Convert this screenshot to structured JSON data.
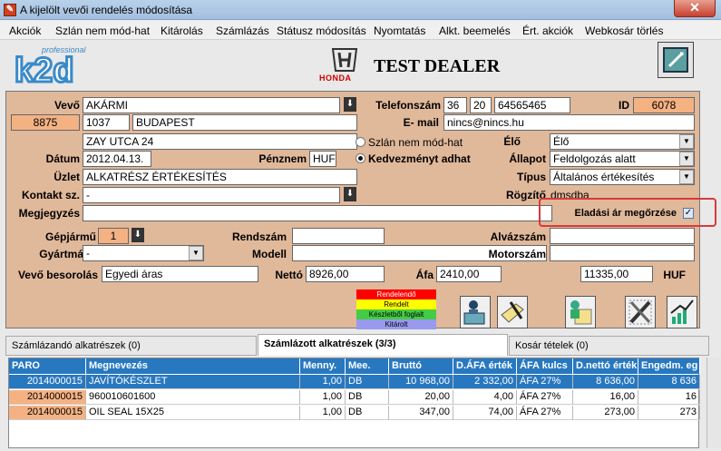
{
  "window": {
    "title": "A kijelölt vevői rendelés módosítása",
    "close": "✕"
  },
  "menu": [
    "Akciók",
    "Szlán nem mód-hat",
    "Kitárolás",
    "Számlázás",
    "Státusz módosítás",
    "Nyomtatás",
    "Alkt. beemelés",
    "Ért. akciók",
    "Webkosár törlés"
  ],
  "header": {
    "logo_small": "professional",
    "logo": "k2d",
    "brand": "HONDA",
    "dealer": "TEST DEALER"
  },
  "form": {
    "vevo_label": "Vevő",
    "vevo": "AKÁRMI",
    "telefon_label": "Telefonszám",
    "tel1": "36",
    "tel2": "20",
    "tel3": "64565465",
    "id_label": "ID",
    "id": "6078",
    "cust_code": "8875",
    "zip": "1037",
    "city": "BUDAPEST",
    "email_label": "E- mail",
    "email": "nincs@nincs.hu",
    "street": "ZAY UTCA 24",
    "radio1": "Szlán nem mód-hat",
    "radio2": "Kedvezményt adhat",
    "elo_label": "Élő",
    "elo": "Élő",
    "datum_label": "Dátum",
    "datum": "2012.04.13.",
    "penznem_label": "Pénznem",
    "penznem": "HUF",
    "allapot_label": "Állapot",
    "allapot": "Feldolgozás alatt",
    "uzlet_label": "Üzlet",
    "uzlet": "ALKATRÉSZ ÉRTÉKESÍTÉS",
    "tipus_label": "Típus",
    "tipus": "Általános értékesítés",
    "kontakt_label": "Kontakt sz.",
    "kontakt": "-",
    "rogzito_label": "Rögzítő",
    "rogzito": "dmsdba",
    "megjegyzes_label": "Megjegyzés",
    "megjegyzes": "",
    "eladasi_label": "Eladási ár megőrzése",
    "eladasi_check": "✓",
    "gepjarmu_label": "Gépjármű",
    "gepjarmu": "1",
    "rendszam_label": "Rendszám",
    "rendszam": "",
    "alvazszam_label": "Alvázszám",
    "alvazszam": "",
    "gyartmany_label": "Gyártmány",
    "gyartmany": "-",
    "modell_label": "Modell",
    "modell": "",
    "motorszam_label": "Motorszám",
    "motorszam": ""
  },
  "summary": {
    "besorolas_label": "Vevő besorolás",
    "besorolas": "Egyedi áras",
    "netto_label": "Nettó",
    "netto": "8926,00",
    "afa_label": "Áfa",
    "afa": "2410,00",
    "total": "11335,00",
    "currency": "HUF"
  },
  "legend": [
    {
      "label": "Rendelendő",
      "color": "#ff0000"
    },
    {
      "label": "Rendelt",
      "color": "#ffff00"
    },
    {
      "label": "Készletből foglalt",
      "color": "#44cc44"
    },
    {
      "label": "Kitárolt",
      "color": "#9999ee"
    }
  ],
  "tabs": [
    "Számlázandó alkatrészek (0)",
    "Számlázott alkatrészek (3/3)",
    "Kosár tételek (0)"
  ],
  "grid": {
    "columns": [
      "PARO",
      "Megnevezés",
      "Menny.",
      "Mee.",
      "Bruttó",
      "D.ÁFA érték",
      "ÁFA kulcs",
      "D.nettó érték",
      "Engedm. eg"
    ],
    "rows": [
      [
        "2014000015",
        "JAVÍTÓKÉSZLET",
        "1,00",
        "DB",
        "10 968,00",
        "2 332,00",
        "ÁFA 27%",
        "8 636,00",
        "8 636"
      ],
      [
        "2014000015",
        "960010601600",
        "1,00",
        "DB",
        "20,00",
        "4,00",
        "ÁFA 27%",
        "16,00",
        "16"
      ],
      [
        "2014000015",
        "OIL SEAL 15X25",
        "1,00",
        "DB",
        "347,00",
        "74,00",
        "ÁFA 27%",
        "273,00",
        "273"
      ]
    ]
  },
  "colors": {
    "accent": "#2878c0",
    "form_bg": "#e0b89a",
    "orange": "#f4b283",
    "highlight": "#d83a3a"
  }
}
